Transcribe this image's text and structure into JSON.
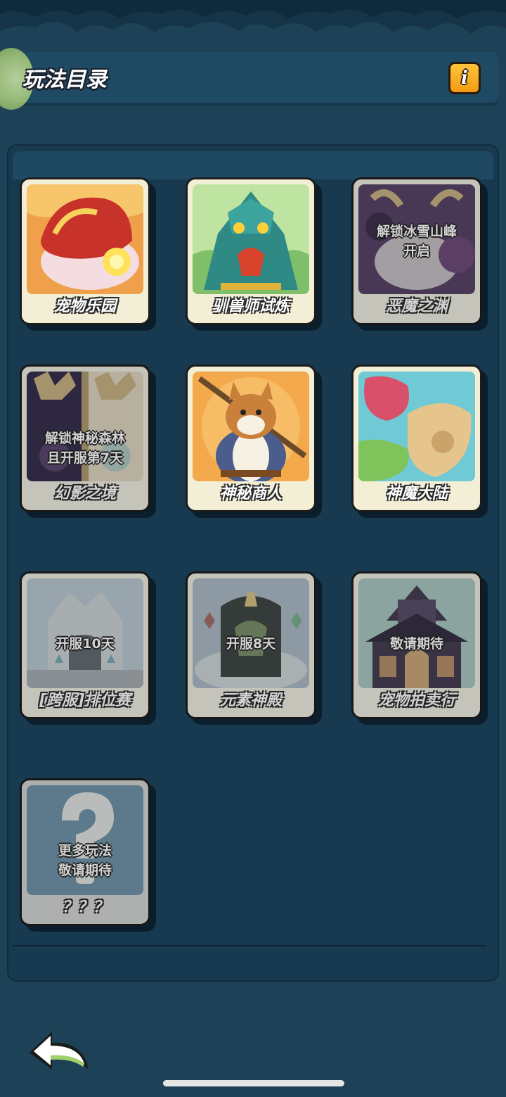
{
  "header": {
    "title": "玩法目录",
    "info_label": "i"
  },
  "cards": [
    {
      "label": "宠物乐园"
    },
    {
      "label": "驯兽师试炼"
    },
    {
      "label": "恶魔之渊",
      "lock_line1": "解锁冰雪山峰",
      "lock_line2": "开启"
    },
    {
      "label": "幻影之境",
      "lock_line1": "解锁神秘森林",
      "lock_line2": "且开服第7天"
    },
    {
      "label": "神秘商人"
    },
    {
      "label": "神魔大陆"
    },
    {
      "label": "[跨服]排位赛",
      "lock_line1": "开服10天"
    },
    {
      "label": "元素神殿",
      "lock_line1": "开服8天"
    },
    {
      "label": "宠物拍卖行",
      "lock_line1": "敬请期待"
    },
    {
      "label": "？？？",
      "lock_line1": "更多玩法",
      "lock_line2": "敬请期待"
    }
  ],
  "colors": {
    "background": "#1d4157",
    "panel": "#173a50",
    "info_button": "#f4a81c"
  },
  "icons": {
    "info": "info-icon",
    "back": "back-arrow-icon"
  }
}
